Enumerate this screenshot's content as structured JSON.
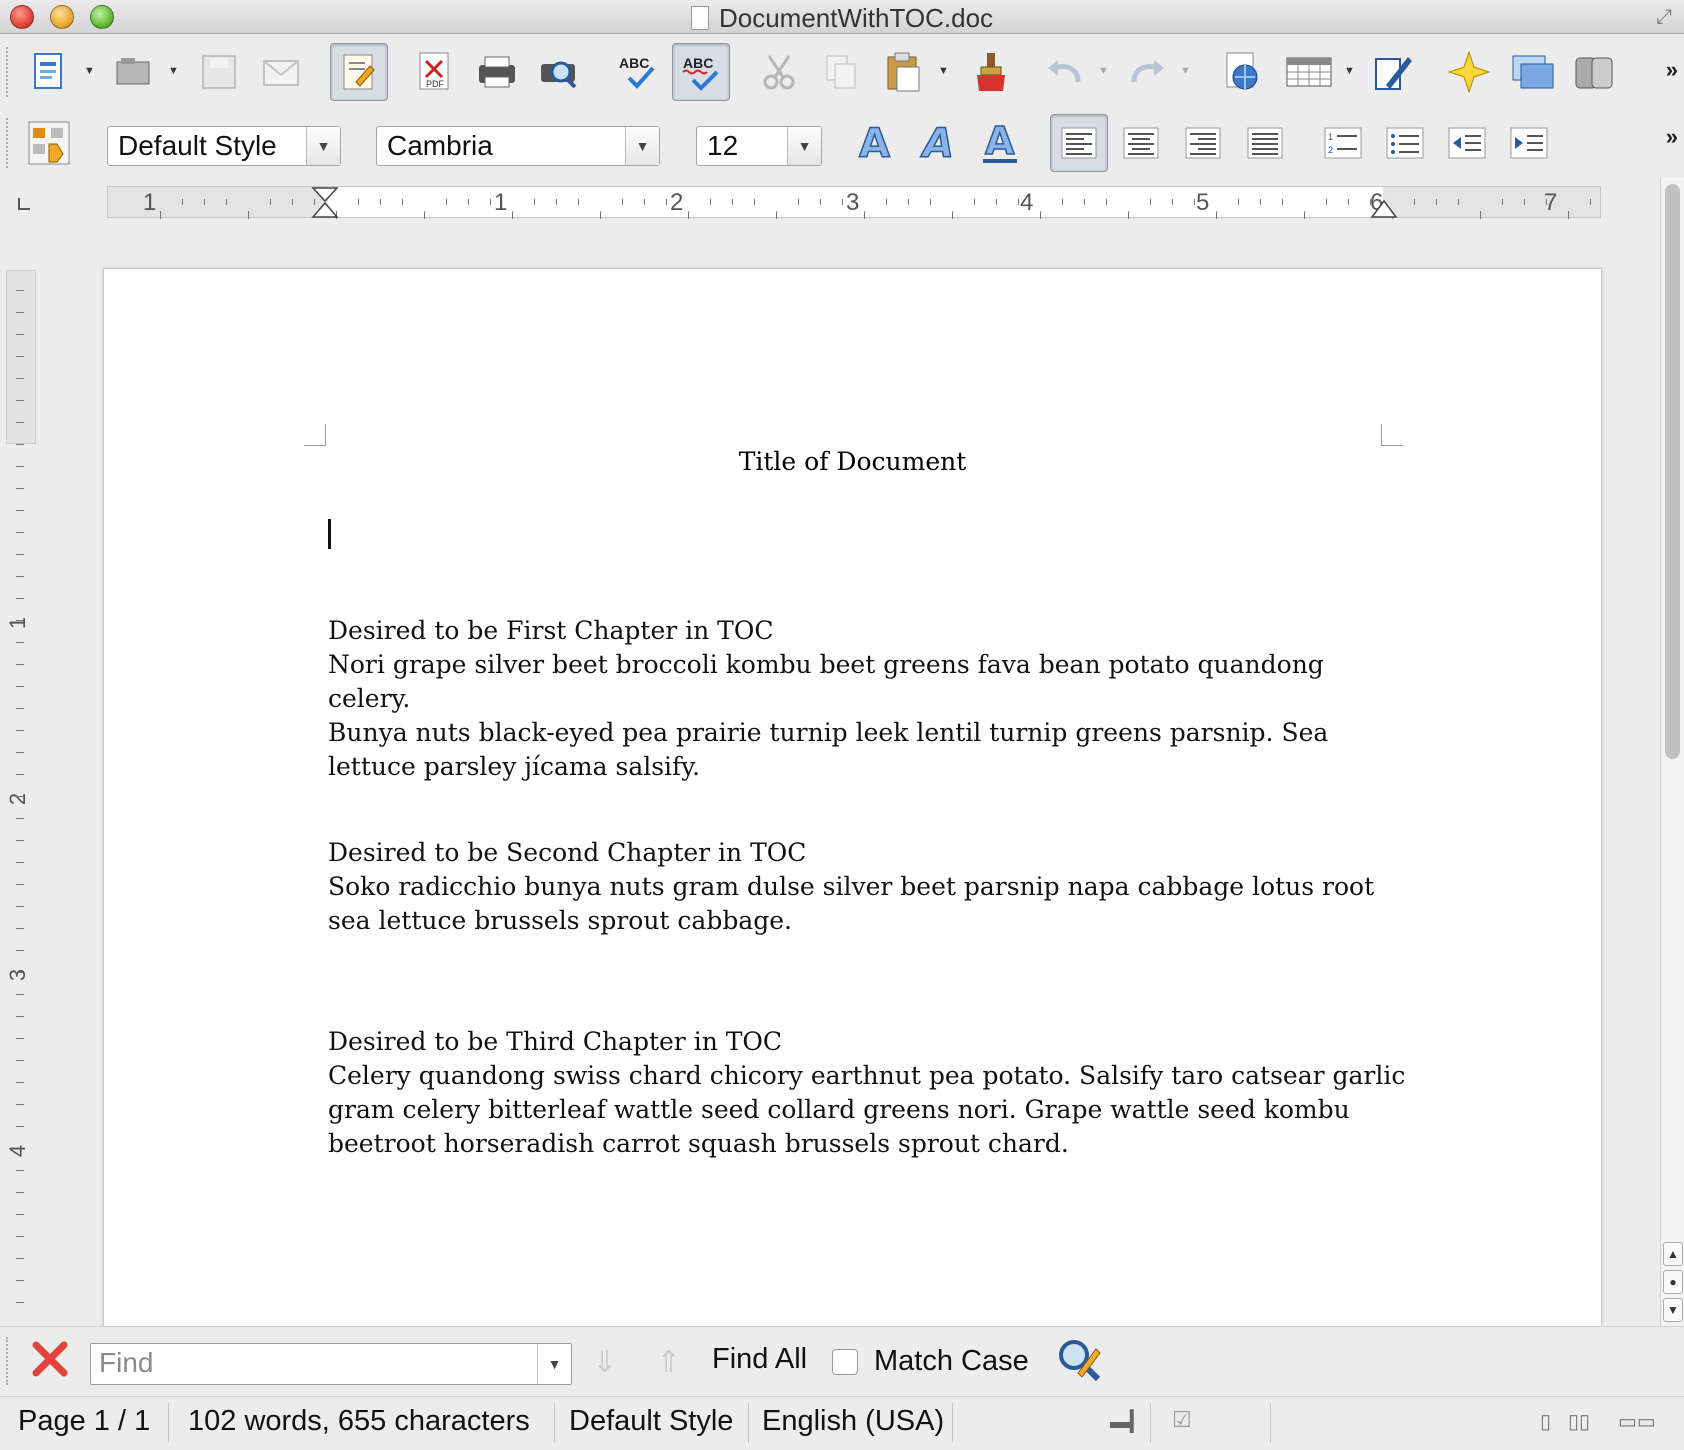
{
  "window": {
    "title": "DocumentWithTOC.doc"
  },
  "formatting": {
    "paragraph_style": "Default Style",
    "font_name": "Cambria",
    "font_size": "12"
  },
  "ruler": {
    "numbers": [
      "1",
      "1",
      "2",
      "3",
      "4",
      "5",
      "6",
      "7"
    ]
  },
  "vruler": {
    "numbers": [
      "1",
      "2",
      "3",
      "4"
    ]
  },
  "document": {
    "title": "Title of Document",
    "chapters": [
      {
        "heading": "Desired to be First Chapter in TOC",
        "lines": [
          "Nori grape silver beet broccoli kombu beet greens fava bean potato quandong celery.",
          "Bunya nuts black-eyed pea prairie turnip leek lentil turnip greens parsnip. Sea",
          "lettuce parsley jícama salsify."
        ]
      },
      {
        "heading": "Desired to be Second Chapter in TOC",
        "lines": [
          "Soko radicchio bunya nuts gram dulse silver beet parsnip napa cabbage lotus root",
          "sea lettuce brussels sprout cabbage."
        ]
      },
      {
        "heading": "Desired to be Third Chapter in TOC",
        "lines": [
          "Celery quandong swiss chard chicory earthnut pea potato. Salsify taro catsear garlic",
          "gram celery bitterleaf wattle seed collard greens nori. Grape wattle seed kombu",
          "beetroot horseradish carrot squash brussels sprout chard."
        ]
      }
    ]
  },
  "findbar": {
    "placeholder": "Find",
    "find_all_label": "Find All",
    "match_case_label": "Match Case"
  },
  "status": {
    "page": "Page 1 / 1",
    "word_count": "102 words, 655 characters",
    "style": "Default Style",
    "language": "English (USA)"
  },
  "icons": {
    "toolbar1": [
      "new-document-icon",
      "open-icon",
      "save-icon",
      "email-icon",
      "edit-mode-icon",
      "export-pdf-icon",
      "print-icon",
      "print-preview-icon",
      "spellcheck-icon",
      "auto-spellcheck-icon",
      "cut-icon",
      "copy-icon",
      "paste-icon",
      "clone-formatting-icon",
      "undo-icon",
      "redo-icon",
      "hyperlink-icon",
      "table-icon",
      "draw-icon",
      "navigator-icon",
      "gallery-icon",
      "data-sources-icon"
    ],
    "toolbar2": [
      "styles-formatting-icon",
      "bold-icon",
      "italic-icon",
      "underline-icon",
      "align-left-icon",
      "align-center-icon",
      "align-right-icon",
      "justify-icon",
      "numbering-icon",
      "bullets-icon",
      "decrease-indent-icon",
      "increase-indent-icon"
    ]
  },
  "colors": {
    "close_red": "#e0443a",
    "accent_blue": "#3a78c8",
    "spell_red": "#e02020"
  }
}
